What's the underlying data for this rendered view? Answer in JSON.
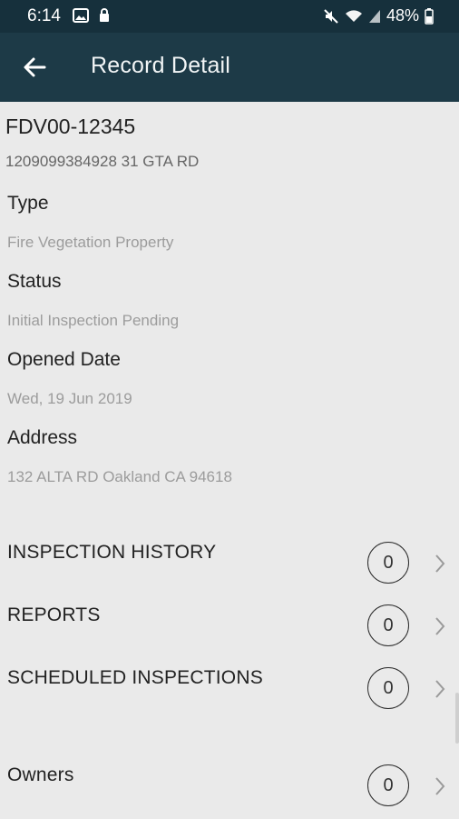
{
  "status_bar": {
    "time": "6:14",
    "battery": "48%"
  },
  "app_bar": {
    "title": "Record Detail"
  },
  "record": {
    "id": "FDV00-12345",
    "subtitle": "1209099384928 31 GTA RD"
  },
  "fields": [
    {
      "label": "Type",
      "value": "Fire Vegetation Property"
    },
    {
      "label": "Status",
      "value": "Initial Inspection Pending"
    },
    {
      "label": "Opened Date",
      "value": "Wed, 19 Jun 2019"
    },
    {
      "label": "Address",
      "value": "132 ALTA RD Oakland CA 94618"
    }
  ],
  "sections": [
    {
      "label": "INSPECTION HISTORY",
      "count": "0"
    },
    {
      "label": "REPORTS",
      "count": "0"
    },
    {
      "label": "SCHEDULED INSPECTIONS",
      "count": "0"
    },
    {
      "label": "Owners",
      "count": "0"
    }
  ],
  "colors": {
    "status_bar": "#16303c",
    "app_bar": "#1d3a47",
    "background": "#eaeaea"
  },
  "icons": [
    "gallery-icon",
    "lock-icon",
    "mute-icon",
    "wifi-icon",
    "signal-icon",
    "battery-icon",
    "back-arrow-icon",
    "chevron-right-icon"
  ]
}
